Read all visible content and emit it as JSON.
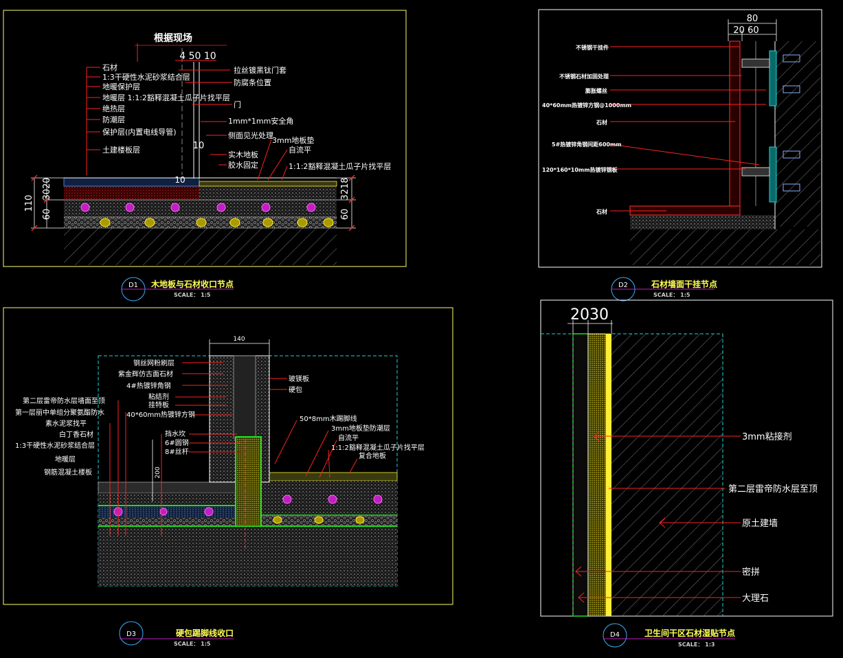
{
  "colors": {
    "background": "#000000",
    "frame": "#ffff66",
    "leader": "#ff2222",
    "label": "#ffffff",
    "dim": "#ffffff",
    "title": "#ffff55",
    "scale": "#cfcfcf",
    "circle": "#3fb0ff",
    "cyan": "#21d4d4",
    "green": "#22dd22",
    "magenta": "#c020c0",
    "yellow": "#ffee33",
    "grey": "#8a8a8a"
  },
  "d1": {
    "tag": "D1",
    "title": "木地板与石材收口节点",
    "scale": "SCALE： 1:5",
    "dim_top": "根据现场",
    "dim_mid": "4 50 10",
    "labels_left": [
      "石材",
      "1:3干硬性水泥砂浆结合层",
      "地暖保护层",
      "地暖层 1:1:2豁释混凝土瓜子片找平层",
      "绝热层",
      "防潮层",
      "保护层(内置电线导管)",
      "土建楼板层"
    ],
    "labels_right": [
      "拉丝镀黑钛门套",
      "防腐条位置",
      "门",
      "1mm*1mm安全角",
      "侧面见光处理",
      "实木地板",
      "胶水固定",
      "3mm地板垫",
      "自流平",
      "1:1:2豁释混凝土瓜子片找平层"
    ],
    "dim_10": "10",
    "dim_10b": "10",
    "dim_left": [
      "110",
      "3020",
      "60"
    ],
    "dim_right": [
      "3218",
      "60"
    ]
  },
  "d2": {
    "tag": "D2",
    "title": "石材墙面干挂节点",
    "scale": "SCALE： 1:5",
    "dim_top": "80",
    "dim_sub": "20 60",
    "labels": [
      "不锈钢干挂件",
      "不锈钢石材加固处理",
      "膨胀螺丝",
      "40*60mm热镀锌方钢@1000mm",
      "石材",
      "5#热镀锌角钢间距600mm",
      "120*160*10mm热镀锌钢板",
      "石材"
    ]
  },
  "d3": {
    "tag": "D3",
    "title": "硬包踢脚线收口",
    "scale": "SCALE： 1:5",
    "dim_top": "140",
    "dim_side": "200",
    "labels_left": [
      "钢丝网粉刷层",
      "紫金辉仿古面石材",
      "4#热镀锌角钢",
      "粘结剂",
      "挂特板",
      "40*60mm热镀锌方钢",
      "第二层雷帝防水层墙面至顶",
      "第一层丽中单组分聚氨酯防水",
      "素水泥浆找平",
      "白丁香石材",
      "1:3干硬性水泥砂浆结合层",
      "地暖层",
      "钢筋混凝土楼板",
      "挡水坎",
      "6#圆钢",
      "8#丝杆"
    ],
    "labels_right": [
      "玻镁板",
      "硬包",
      "50*8mm木踢脚线",
      "3mm地板垫防潮层",
      "自流平",
      "1:1:2豁释混凝土瓜子片找平层",
      "复合地板"
    ]
  },
  "d4": {
    "tag": "D4",
    "title": "卫生间干区石材湿贴节点",
    "scale": "SCALE： 1:3",
    "dim_top": "2030",
    "labels": [
      "3mm粘接剂",
      "第二层雷帝防水层至顶",
      "原土建墙",
      "密拼",
      "大理石"
    ]
  }
}
